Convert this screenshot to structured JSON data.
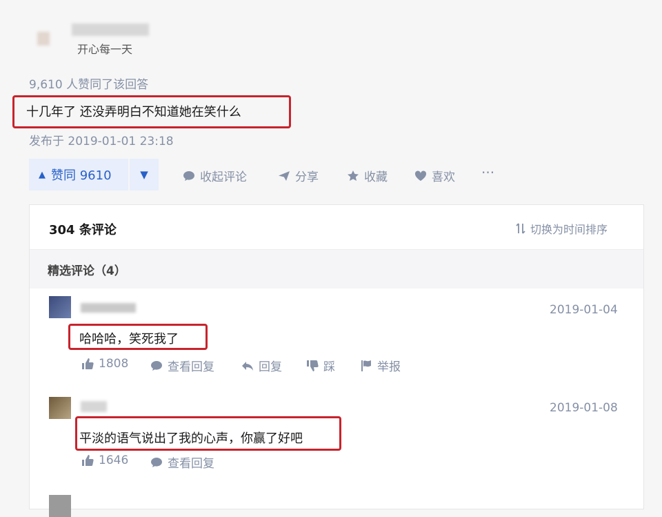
{
  "answer": {
    "author_signature": "开心每一天",
    "votes_text": "9,610 人赞同了该回答",
    "content": "十几年了 还没弄明白不知道她在笑什么",
    "published": "发布于 2019-01-01 23:18"
  },
  "actions": {
    "upvote_label": "赞同 9610",
    "collapse_comments": "收起评论",
    "share": "分享",
    "favorite": "收藏",
    "like": "喜欢",
    "more": "···"
  },
  "comments_panel": {
    "count_title": "304 条评论",
    "sort_toggle": "切换为时间排序",
    "featured_title": "精选评论（4）",
    "comments": [
      {
        "date": "2019-01-04",
        "text": "哈哈哈，笑死我了",
        "likes": "1808",
        "view_replies": "查看回复",
        "reply": "回复",
        "dislike": "踩",
        "report": "举报"
      },
      {
        "date": "2019-01-08",
        "text": "平淡的语气说出了我的心声，你赢了好吧",
        "likes": "1646",
        "view_replies": "查看回复"
      }
    ]
  },
  "colors": {
    "accent_blue": "#2761c9",
    "highlight_red": "#c8232c",
    "meta_gray": "#8590a6"
  }
}
